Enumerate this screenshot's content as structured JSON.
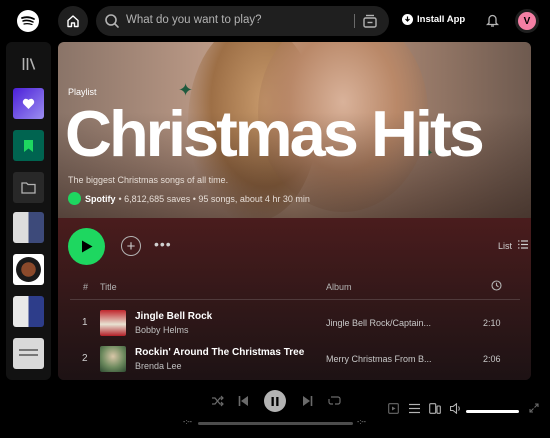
{
  "topbar": {
    "search_placeholder": "What do you want to play?",
    "install_label": "Install App",
    "avatar_letter": "V"
  },
  "sidebar": {
    "items": [
      "your-library",
      "liked-songs",
      "your-episodes",
      "folder",
      "playlist-1",
      "playlist-2",
      "playlist-3",
      "playlist-4"
    ]
  },
  "playlist": {
    "type_label": "Playlist",
    "title": "Christmas Hits",
    "description": "The biggest Christmas songs of all time.",
    "owner": "Spotify",
    "meta": "• 6,812,685 saves • 95 songs, about 4 hr 30 min"
  },
  "controls": {
    "view_label": "List"
  },
  "table": {
    "headers": {
      "num": "#",
      "title": "Title",
      "album": "Album"
    },
    "rows": [
      {
        "num": "1",
        "title": "Jingle Bell Rock",
        "artist": "Bobby Helms",
        "album": "Jingle Bell Rock/Captain...",
        "duration": "2:10"
      },
      {
        "num": "2",
        "title": "Rockin' Around The Christmas Tree",
        "artist": "Brenda Lee",
        "album": "Merry Christmas From B...",
        "duration": "2:06"
      }
    ]
  },
  "player": {
    "time_elapsed": "-:--",
    "time_total": "-:--"
  },
  "colors": {
    "accent": "#1ed760",
    "background": "#000000",
    "avatar": "#f47fa4"
  }
}
